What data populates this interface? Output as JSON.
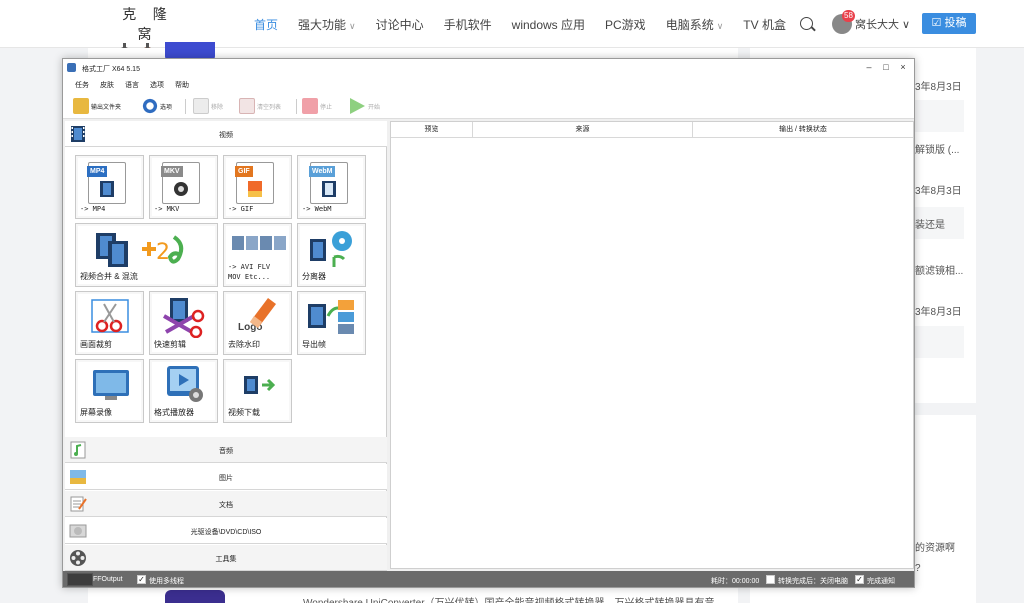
{
  "site": {
    "logo_text": "克 隆 窝",
    "nav": [
      {
        "label": "首页",
        "caret": ""
      },
      {
        "label": "强大功能",
        "caret": "∨"
      },
      {
        "label": "讨论中心",
        "caret": ""
      },
      {
        "label": "手机软件",
        "caret": ""
      },
      {
        "label": "windows 应用",
        "caret": ""
      },
      {
        "label": "PC游戏",
        "caret": ""
      },
      {
        "label": "电脑系统",
        "caret": "∨"
      },
      {
        "label": "TV 机盒",
        "caret": ""
      }
    ],
    "notif_count": "58",
    "user_name": "窝长大大 ∨",
    "post_button": "☑ 投稿",
    "side_texts": [
      "3年8月3日",
      "解锁版 (...",
      "3年8月3日",
      "装还是",
      "额滤镜相...",
      "3年8月3日",
      "的资源啊",
      "?"
    ],
    "bottom_text": "Wondershare UniConverter（万兴优转）国产全能音视频格式转换器，万兴格式转换器具有音"
  },
  "app": {
    "title": "格式工厂 X64 5.15",
    "window_controls": {
      "minimize": "–",
      "maximize": "□",
      "close": "×"
    },
    "menu": [
      "任务",
      "皮肤",
      "语言",
      "选项",
      "帮助"
    ],
    "toolbar": {
      "output_folder": "输出文件夹",
      "options": "选项",
      "remove": "移除",
      "clear_list": "清空列表",
      "stop": "停止",
      "start": "开始"
    },
    "categories": {
      "video": "视频",
      "audio": "音频",
      "image": "图片",
      "document": "文档",
      "disc": "光驱设备\\DVD\\CD\\ISO",
      "tools": "工具集"
    },
    "tiles": {
      "mp4": {
        "tag": "MP4",
        "label": "-> MP4"
      },
      "mkv": {
        "tag": "MKV",
        "label": "-> MKV"
      },
      "gif": {
        "tag": "GIF",
        "label": "-> GIF"
      },
      "webm": {
        "tag": "WebM",
        "label": "-> WebM"
      },
      "merge": "视频合并 & 混流",
      "avi_line1": "-> AVI FLV",
      "avi_line2": "MOV Etc...",
      "splitter": "分离器",
      "crop": "画面裁剪",
      "quick_clip": "快速剪辑",
      "remove_watermark": "去除水印",
      "export_frames": "导出帧",
      "screen_record": "屏幕录像",
      "player": "格式播放器",
      "video_download": "视频下载",
      "logo_text": "Logo"
    },
    "columns": [
      "预览",
      "来源",
      "输出 / 转换状态"
    ],
    "status": {
      "ffoutput": "FFOutput",
      "multithread": "使用多线程",
      "elapsed": "耗时：00:00:00",
      "after_convert": "转换完成后：关闭电脑",
      "notify": "完成通知",
      "check": "✓"
    },
    "colors": {
      "mp4": "#2c6fc2",
      "mkv": "#8a8a8a",
      "gif": "#e2761f",
      "webm": "#5aa0d8",
      "accent": "#3a8de0"
    }
  }
}
